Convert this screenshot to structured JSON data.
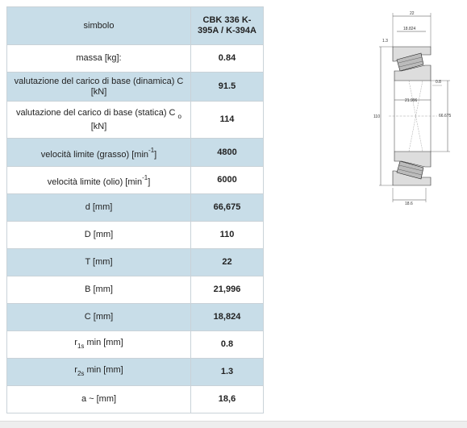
{
  "table": {
    "header": {
      "label": "simbolo",
      "value": "CBK 336 K-395A / K-394A"
    },
    "rows": [
      {
        "label": "massa [kg]:",
        "value": "0.84"
      },
      {
        "label": "valutazione del carico di base (dinamica) C [kN]",
        "value": "91.5"
      },
      {
        "label_main": "valutazione del carico di base (statica) C",
        "label_sub": "o",
        "label_tail": "[kN]",
        "value": "114"
      },
      {
        "label_main": "velocità limite (grasso) [min",
        "label_sup": "-1",
        "label_tail": "]",
        "value": "4800"
      },
      {
        "label_main": "velocità limite (olio) [min",
        "label_sup": "-1",
        "label_tail": "]",
        "value": "6000"
      },
      {
        "label": "d [mm]",
        "value": "66,675"
      },
      {
        "label": "D [mm]",
        "value": "110"
      },
      {
        "label": "T [mm]",
        "value": "22"
      },
      {
        "label": "B [mm]",
        "value": "21,996"
      },
      {
        "label": "C [mm]",
        "value": "18,824"
      },
      {
        "label_main": "r",
        "label_sub": "1s",
        "label_tail": "min [mm]",
        "value": "0.8"
      },
      {
        "label_main": "r",
        "label_sub": "2s",
        "label_tail": "min [mm]",
        "value": "1.3"
      },
      {
        "label": "a ~ [mm]",
        "value": "18,6"
      }
    ]
  },
  "drawing": {
    "dims": {
      "T": "22",
      "C": "18.824",
      "r2": "1.3",
      "r1": "0.8",
      "B": "21.996",
      "D": "110",
      "d": "66.675",
      "a": "18.6"
    }
  }
}
